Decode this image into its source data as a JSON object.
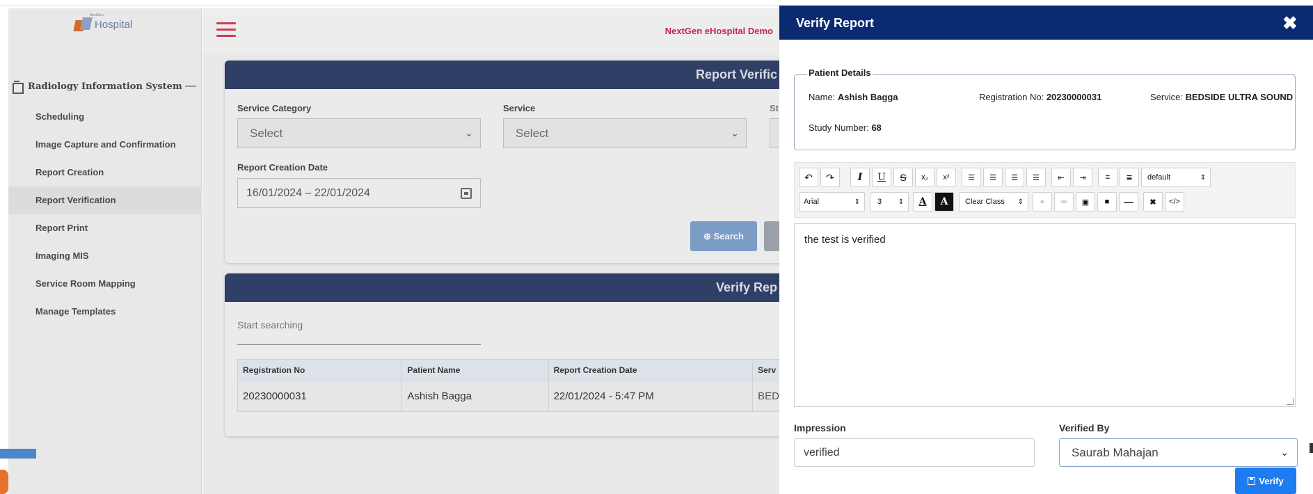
{
  "app": {
    "logo_text": "Hospital",
    "logo_small_text": "NextGen",
    "brand": "NextGen eHospital Demo"
  },
  "sidebar": {
    "section_title": "Radiology Information System",
    "collapse_symbol": "—",
    "items": [
      {
        "label": "Scheduling"
      },
      {
        "label": "Image Capture and Confirmation"
      },
      {
        "label": "Report Creation"
      },
      {
        "label": "Report Verification",
        "active": true
      },
      {
        "label": "Report Print"
      },
      {
        "label": "Imaging MIS"
      },
      {
        "label": "Service Room Mapping"
      },
      {
        "label": "Manage Templates"
      }
    ]
  },
  "filter_card": {
    "title": "Report Verific",
    "service_category_label": "Service Category",
    "service_category_value": "Select",
    "service_label": "Service",
    "service_value": "Select",
    "third_label_partial": "St",
    "date_label": "Report Creation Date",
    "date_value": "16/01/2024  – 22/01/2024",
    "search_button": "Search"
  },
  "list_card": {
    "title": "Verify Rep",
    "search_placeholder": "Start searching",
    "columns": [
      "Registration No",
      "Patient Name",
      "Report Creation Date",
      "Serv"
    ],
    "rows": [
      [
        "20230000031",
        "Ashish Bagga",
        "22/01/2024 - 5:47 PM",
        "BED"
      ]
    ]
  },
  "modal": {
    "title": "Verify Report",
    "close_symbol": "✖",
    "patient_details_legend": "Patient Details",
    "name_label": "Name: ",
    "name_value": "Ashish Bagga",
    "reg_label": "Registration No: ",
    "reg_value": "20230000031",
    "service_label": "Service: ",
    "service_value": "BEDSIDE ULTRA SOUND",
    "study_label": "Study Number: ",
    "study_value": "68",
    "toolbar": {
      "style_select": "default",
      "font_select": "Arial",
      "size_select": "3",
      "clear_class": "Clear Class"
    },
    "editor_text": "the test is verified",
    "impression_label": "Impression",
    "impression_value": "verified",
    "verified_by_label": "Verified By",
    "verified_by_value": "Saurab Mahajan",
    "verify_button": "Verify"
  },
  "colors": {
    "modal_header": "#0a2a72",
    "card_header": "#303f66",
    "brand": "#c8244a",
    "primary_button": "#1f7cf0"
  }
}
